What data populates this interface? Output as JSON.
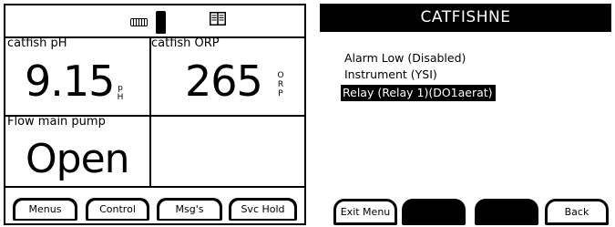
{
  "status_bar": {
    "icons": [
      "keyboard-icon",
      "battery-icon",
      "book-icon"
    ]
  },
  "readings": {
    "ph": {
      "label": "catfish pH",
      "value": "9.15",
      "unit_top": "p",
      "unit_bottom": "H"
    },
    "orp": {
      "label": "catfish ORP",
      "value": "265",
      "unit_lines": [
        "O",
        "R",
        "P"
      ]
    },
    "flow": {
      "label": "Flow main pump",
      "value": "Open"
    }
  },
  "left_softkeys": [
    "Menus",
    "Control",
    "Msg's",
    "Svc Hold"
  ],
  "menu": {
    "title": "CATFISHNE",
    "items": [
      {
        "label": "Alarm Low (Disabled)",
        "selected": false
      },
      {
        "label": "Instrument (YSI)",
        "selected": false
      },
      {
        "label": "Relay (Relay 1)(DO1aerat)",
        "selected": true
      }
    ]
  },
  "right_softkeys": [
    "Exit Menu",
    "",
    "",
    "Back"
  ],
  "colors": {
    "foreground": "#000000",
    "background": "#ffffff"
  }
}
